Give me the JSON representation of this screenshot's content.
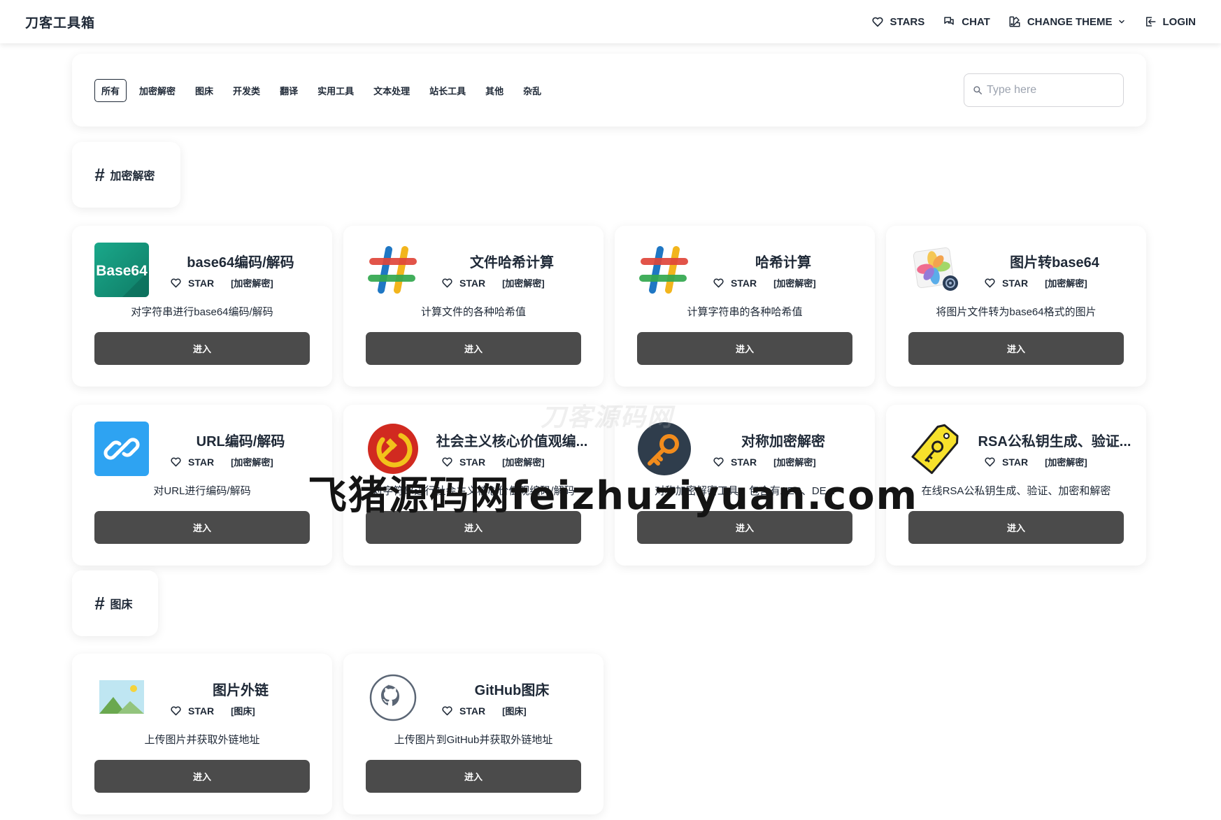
{
  "navbar": {
    "brand": "刀客工具箱",
    "stars": "STARS",
    "chat": "CHAT",
    "change_theme": "CHANGE THEME",
    "login": "LOGIN"
  },
  "filter": {
    "tabs": [
      "所有",
      "加密解密",
      "图床",
      "开发类",
      "翻译",
      "实用工具",
      "文本处理",
      "站长工具",
      "其他",
      "杂乱"
    ],
    "active_tab": "所有",
    "search_placeholder": "Type here"
  },
  "sections": [
    {
      "title": "加密解密",
      "tools": [
        {
          "name": "base64编码/解码",
          "star": "STAR",
          "tag": "[加密解密]",
          "desc": "对字符串进行base64编码/解码",
          "button": "进入",
          "icon": "base64-icon"
        },
        {
          "name": "文件哈希计算",
          "star": "STAR",
          "tag": "[加密解密]",
          "desc": "计算文件的各种哈希值",
          "button": "进入",
          "icon": "hash-icon"
        },
        {
          "name": "哈希计算",
          "star": "STAR",
          "tag": "[加密解密]",
          "desc": "计算字符串的各种哈希值",
          "button": "进入",
          "icon": "hash-icon"
        },
        {
          "name": "图片转base64",
          "star": "STAR",
          "tag": "[加密解密]",
          "desc": "将图片文件转为base64格式的图片",
          "button": "进入",
          "icon": "photos-icon"
        },
        {
          "name": "URL编码/解码",
          "star": "STAR",
          "tag": "[加密解密]",
          "desc": "对URL进行编码/解码",
          "button": "进入",
          "icon": "link-icon"
        },
        {
          "name": "社会主义核心价值观编...",
          "star": "STAR",
          "tag": "[加密解密]",
          "desc": "对字符串进行社会主义核心价值观编码/解码",
          "button": "进入",
          "icon": "hammer-sickle-icon"
        },
        {
          "name": "对称加密解密",
          "star": "STAR",
          "tag": "[加密解密]",
          "desc": "对称加密解密工具，包含有AES、DE...",
          "button": "进入",
          "icon": "key-icon"
        },
        {
          "name": "RSA公私钥生成、验证...",
          "star": "STAR",
          "tag": "[加密解密]",
          "desc": "在线RSA公私钥生成、验证、加密和解密",
          "button": "进入",
          "icon": "key-tag-icon"
        }
      ]
    },
    {
      "title": "图床",
      "tools": [
        {
          "name": "图片外链",
          "star": "STAR",
          "tag": "[图床]",
          "desc": "上传图片并获取外链地址",
          "button": "进入",
          "icon": "landscape-image-icon"
        },
        {
          "name": "GitHub图床",
          "star": "STAR",
          "tag": "[图床]",
          "desc": "上传图片到GitHub并获取外链地址",
          "button": "进入",
          "icon": "github-icon"
        }
      ]
    }
  ],
  "watermark": {
    "faint": "刀客源码网",
    "main": "飞猪源码网feizhuziyuan.com"
  }
}
